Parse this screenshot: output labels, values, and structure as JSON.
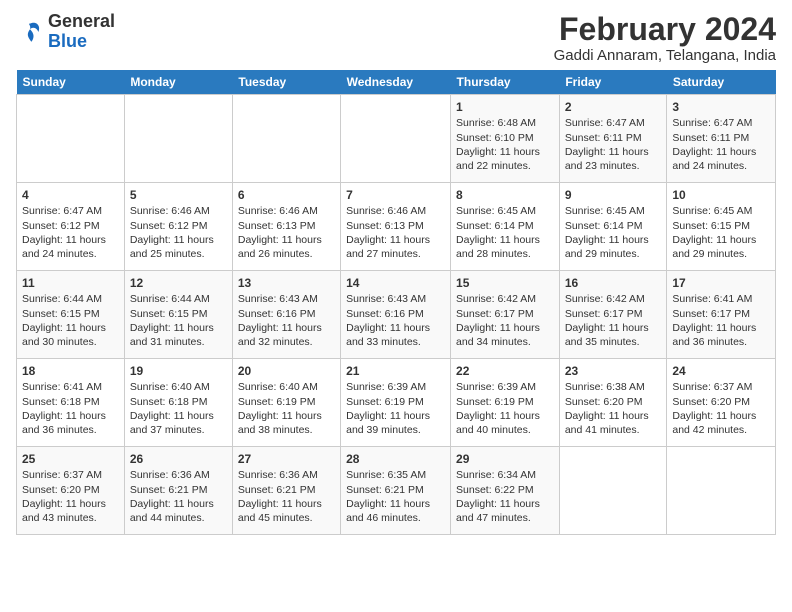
{
  "header": {
    "logo": {
      "general": "General",
      "blue": "Blue"
    },
    "title": "February 2024",
    "subtitle": "Gaddi Annaram, Telangana, India"
  },
  "weekdays": [
    "Sunday",
    "Monday",
    "Tuesday",
    "Wednesday",
    "Thursday",
    "Friday",
    "Saturday"
  ],
  "weeks": [
    [
      {
        "day": "",
        "info": ""
      },
      {
        "day": "",
        "info": ""
      },
      {
        "day": "",
        "info": ""
      },
      {
        "day": "",
        "info": ""
      },
      {
        "day": "1",
        "info": "Sunrise: 6:48 AM\nSunset: 6:10 PM\nDaylight: 11 hours\nand 22 minutes."
      },
      {
        "day": "2",
        "info": "Sunrise: 6:47 AM\nSunset: 6:11 PM\nDaylight: 11 hours\nand 23 minutes."
      },
      {
        "day": "3",
        "info": "Sunrise: 6:47 AM\nSunset: 6:11 PM\nDaylight: 11 hours\nand 24 minutes."
      }
    ],
    [
      {
        "day": "4",
        "info": "Sunrise: 6:47 AM\nSunset: 6:12 PM\nDaylight: 11 hours\nand 24 minutes."
      },
      {
        "day": "5",
        "info": "Sunrise: 6:46 AM\nSunset: 6:12 PM\nDaylight: 11 hours\nand 25 minutes."
      },
      {
        "day": "6",
        "info": "Sunrise: 6:46 AM\nSunset: 6:13 PM\nDaylight: 11 hours\nand 26 minutes."
      },
      {
        "day": "7",
        "info": "Sunrise: 6:46 AM\nSunset: 6:13 PM\nDaylight: 11 hours\nand 27 minutes."
      },
      {
        "day": "8",
        "info": "Sunrise: 6:45 AM\nSunset: 6:14 PM\nDaylight: 11 hours\nand 28 minutes."
      },
      {
        "day": "9",
        "info": "Sunrise: 6:45 AM\nSunset: 6:14 PM\nDaylight: 11 hours\nand 29 minutes."
      },
      {
        "day": "10",
        "info": "Sunrise: 6:45 AM\nSunset: 6:15 PM\nDaylight: 11 hours\nand 29 minutes."
      }
    ],
    [
      {
        "day": "11",
        "info": "Sunrise: 6:44 AM\nSunset: 6:15 PM\nDaylight: 11 hours\nand 30 minutes."
      },
      {
        "day": "12",
        "info": "Sunrise: 6:44 AM\nSunset: 6:15 PM\nDaylight: 11 hours\nand 31 minutes."
      },
      {
        "day": "13",
        "info": "Sunrise: 6:43 AM\nSunset: 6:16 PM\nDaylight: 11 hours\nand 32 minutes."
      },
      {
        "day": "14",
        "info": "Sunrise: 6:43 AM\nSunset: 6:16 PM\nDaylight: 11 hours\nand 33 minutes."
      },
      {
        "day": "15",
        "info": "Sunrise: 6:42 AM\nSunset: 6:17 PM\nDaylight: 11 hours\nand 34 minutes."
      },
      {
        "day": "16",
        "info": "Sunrise: 6:42 AM\nSunset: 6:17 PM\nDaylight: 11 hours\nand 35 minutes."
      },
      {
        "day": "17",
        "info": "Sunrise: 6:41 AM\nSunset: 6:17 PM\nDaylight: 11 hours\nand 36 minutes."
      }
    ],
    [
      {
        "day": "18",
        "info": "Sunrise: 6:41 AM\nSunset: 6:18 PM\nDaylight: 11 hours\nand 36 minutes."
      },
      {
        "day": "19",
        "info": "Sunrise: 6:40 AM\nSunset: 6:18 PM\nDaylight: 11 hours\nand 37 minutes."
      },
      {
        "day": "20",
        "info": "Sunrise: 6:40 AM\nSunset: 6:19 PM\nDaylight: 11 hours\nand 38 minutes."
      },
      {
        "day": "21",
        "info": "Sunrise: 6:39 AM\nSunset: 6:19 PM\nDaylight: 11 hours\nand 39 minutes."
      },
      {
        "day": "22",
        "info": "Sunrise: 6:39 AM\nSunset: 6:19 PM\nDaylight: 11 hours\nand 40 minutes."
      },
      {
        "day": "23",
        "info": "Sunrise: 6:38 AM\nSunset: 6:20 PM\nDaylight: 11 hours\nand 41 minutes."
      },
      {
        "day": "24",
        "info": "Sunrise: 6:37 AM\nSunset: 6:20 PM\nDaylight: 11 hours\nand 42 minutes."
      }
    ],
    [
      {
        "day": "25",
        "info": "Sunrise: 6:37 AM\nSunset: 6:20 PM\nDaylight: 11 hours\nand 43 minutes."
      },
      {
        "day": "26",
        "info": "Sunrise: 6:36 AM\nSunset: 6:21 PM\nDaylight: 11 hours\nand 44 minutes."
      },
      {
        "day": "27",
        "info": "Sunrise: 6:36 AM\nSunset: 6:21 PM\nDaylight: 11 hours\nand 45 minutes."
      },
      {
        "day": "28",
        "info": "Sunrise: 6:35 AM\nSunset: 6:21 PM\nDaylight: 11 hours\nand 46 minutes."
      },
      {
        "day": "29",
        "info": "Sunrise: 6:34 AM\nSunset: 6:22 PM\nDaylight: 11 hours\nand 47 minutes."
      },
      {
        "day": "",
        "info": ""
      },
      {
        "day": "",
        "info": ""
      }
    ]
  ]
}
